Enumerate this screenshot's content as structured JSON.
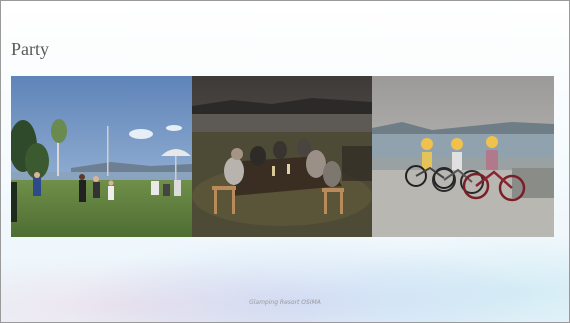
{
  "slide": {
    "title": "Party",
    "footer": "Glamping Resort OSIMA"
  },
  "photos": [
    {
      "name": "lawn-party-photo"
    },
    {
      "name": "night-dinner-photo"
    },
    {
      "name": "cycling-group-photo"
    }
  ]
}
